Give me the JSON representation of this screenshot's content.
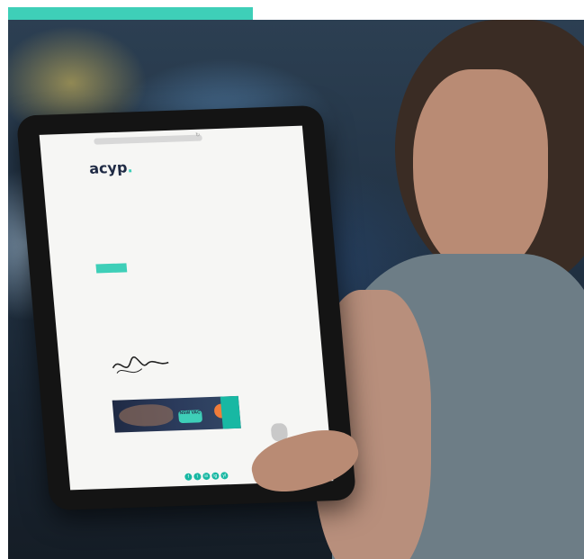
{
  "colors": {
    "accent": "#3ecfb8",
    "logo_navy": "#1f2a44",
    "banner_orange": "#f07c3a",
    "social": "#18b8a3"
  },
  "scene": {
    "subject": "child-holding-tablet",
    "device": "tablet"
  },
  "email": {
    "logo_text": "acyp",
    "logo_dot": ".",
    "button_label": "",
    "banner_badge": "NSW VAC",
    "social_icons": [
      "f",
      "t",
      "in",
      "ig",
      "yt"
    ]
  }
}
